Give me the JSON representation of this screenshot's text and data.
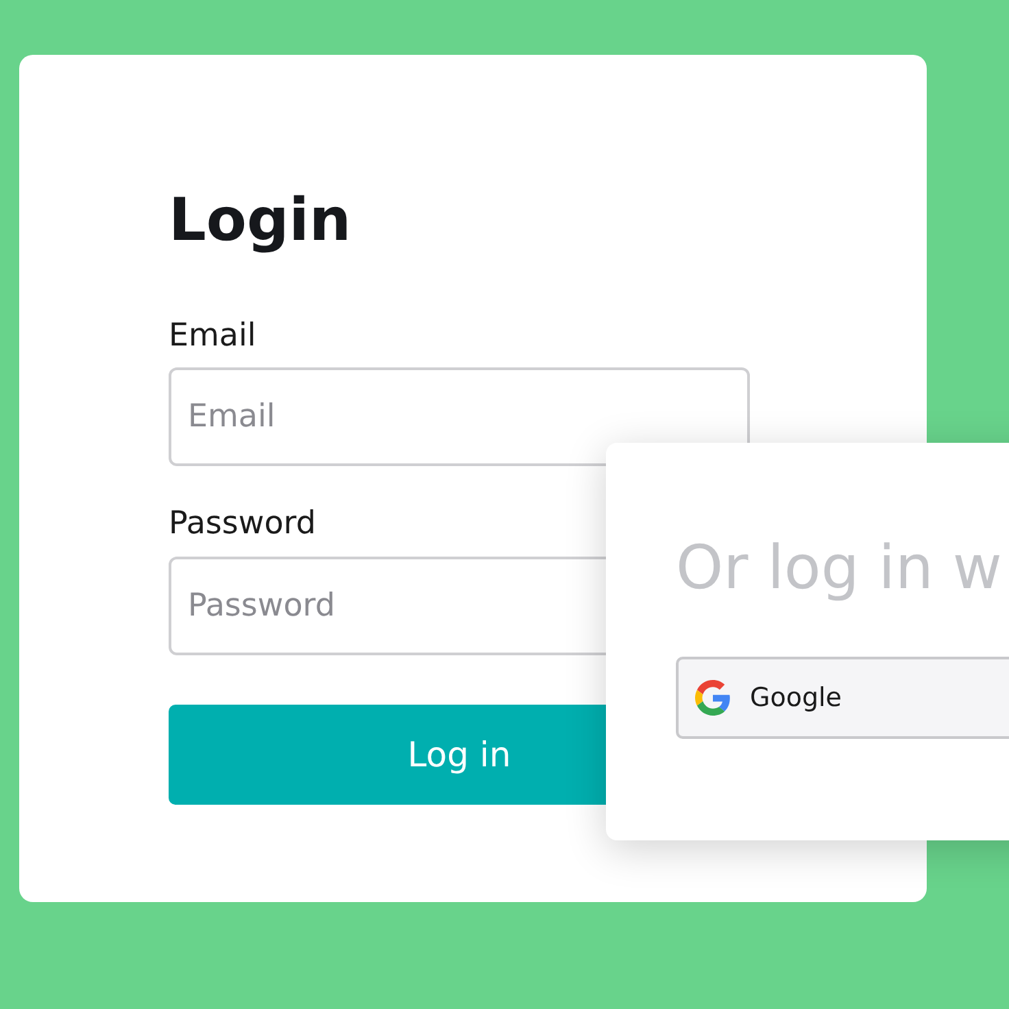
{
  "login_card": {
    "title": "Login",
    "fields": [
      {
        "label": "Email",
        "placeholder": "Email"
      },
      {
        "label": "Password",
        "placeholder": "Password"
      }
    ],
    "submit_button": "Log in"
  },
  "social_card": {
    "heading": "Or log in w",
    "buttons": [
      {
        "label": "Google"
      }
    ]
  }
}
